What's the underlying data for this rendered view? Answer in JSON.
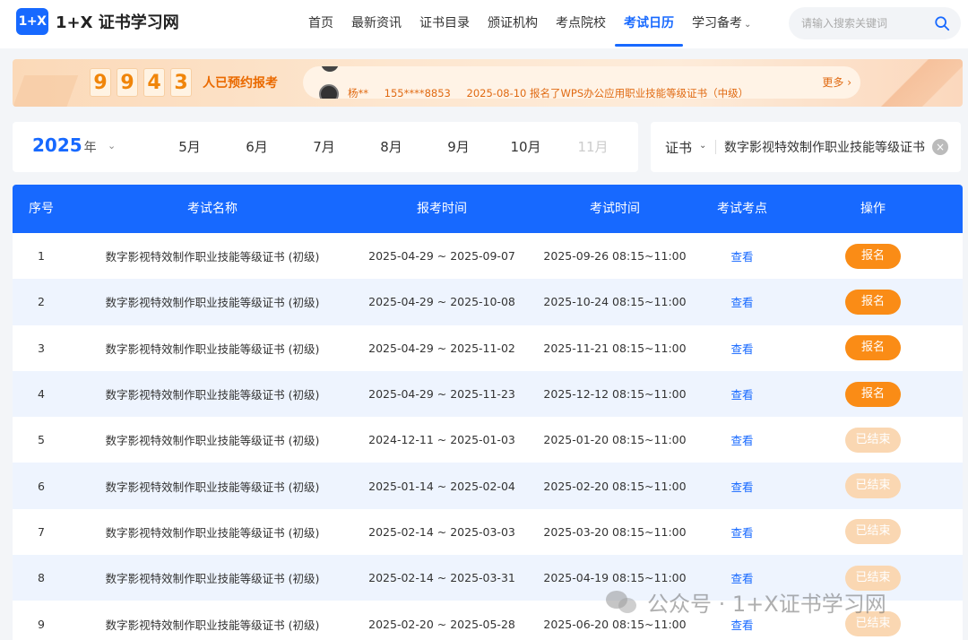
{
  "header": {
    "logo_mark": "1+X",
    "logo_text": "1+X 证书学习网",
    "nav": [
      {
        "label": "首页",
        "active": false
      },
      {
        "label": "最新资讯",
        "active": false
      },
      {
        "label": "证书目录",
        "active": false
      },
      {
        "label": "颁证机构",
        "active": false
      },
      {
        "label": "考点院校",
        "active": false
      },
      {
        "label": "考试日历",
        "active": true
      },
      {
        "label": "学习备考",
        "active": false,
        "dropdown": true
      }
    ],
    "search_placeholder": "请输入搜索关键词"
  },
  "banner": {
    "digits": [
      "9",
      "9",
      "4",
      "3"
    ],
    "booked_label": "人已预约报考",
    "ticker": {
      "name": "杨**",
      "phone": "155****8853",
      "message": "2025-08-10 报名了WPS办公应用职业技能等级证书（中级）"
    },
    "more": "更多 ›"
  },
  "filters": {
    "year": "2025",
    "year_suffix": "年",
    "months": [
      "5月",
      "6月",
      "7月",
      "8月",
      "9月",
      "10月",
      "11月"
    ],
    "cert_label": "证书",
    "cert_value": "数字影视特效制作职业技能等级证书"
  },
  "table": {
    "headers": [
      "序号",
      "考试名称",
      "报考时间",
      "考试时间",
      "考试考点",
      "操作"
    ],
    "rows": [
      {
        "no": "1",
        "name": "数字影视特效制作职业技能等级证书 (初级)",
        "reg": "2025-04-29 ~ 2025-09-07",
        "exam": "2025-09-26 08:15~11:00",
        "venue": "查看",
        "action": "报名",
        "status": "open"
      },
      {
        "no": "2",
        "name": "数字影视特效制作职业技能等级证书 (初级)",
        "reg": "2025-04-29 ~ 2025-10-08",
        "exam": "2025-10-24 08:15~11:00",
        "venue": "查看",
        "action": "报名",
        "status": "open"
      },
      {
        "no": "3",
        "name": "数字影视特效制作职业技能等级证书 (初级)",
        "reg": "2025-04-29 ~ 2025-11-02",
        "exam": "2025-11-21 08:15~11:00",
        "venue": "查看",
        "action": "报名",
        "status": "open"
      },
      {
        "no": "4",
        "name": "数字影视特效制作职业技能等级证书 (初级)",
        "reg": "2025-04-29 ~ 2025-11-23",
        "exam": "2025-12-12 08:15~11:00",
        "venue": "查看",
        "action": "报名",
        "status": "open"
      },
      {
        "no": "5",
        "name": "数字影视特效制作职业技能等级证书 (初级)",
        "reg": "2024-12-11 ~ 2025-01-03",
        "exam": "2025-01-20 08:15~11:00",
        "venue": "查看",
        "action": "已结束",
        "status": "closed"
      },
      {
        "no": "6",
        "name": "数字影视特效制作职业技能等级证书 (初级)",
        "reg": "2025-01-14 ~ 2025-02-04",
        "exam": "2025-02-20 08:15~11:00",
        "venue": "查看",
        "action": "已结束",
        "status": "closed"
      },
      {
        "no": "7",
        "name": "数字影视特效制作职业技能等级证书 (初级)",
        "reg": "2025-02-14 ~ 2025-03-03",
        "exam": "2025-03-20 08:15~11:00",
        "venue": "查看",
        "action": "已结束",
        "status": "closed"
      },
      {
        "no": "8",
        "name": "数字影视特效制作职业技能等级证书 (初级)",
        "reg": "2025-02-14 ~ 2025-03-31",
        "exam": "2025-04-19 08:15~11:00",
        "venue": "查看",
        "action": "已结束",
        "status": "closed"
      },
      {
        "no": "9",
        "name": "数字影视特效制作职业技能等级证书 (初级)",
        "reg": "2025-02-20 ~ 2025-05-28",
        "exam": "2025-06-20 08:15~11:00",
        "venue": "查看",
        "action": "已结束",
        "status": "closed"
      }
    ]
  },
  "watermark": "公众号 · 1+X证书学习网",
  "colors": {
    "primary": "#1769ff",
    "orange": "#fa8c16",
    "orange_light": "#fad7b2",
    "row_alt": "#eef4fe"
  }
}
